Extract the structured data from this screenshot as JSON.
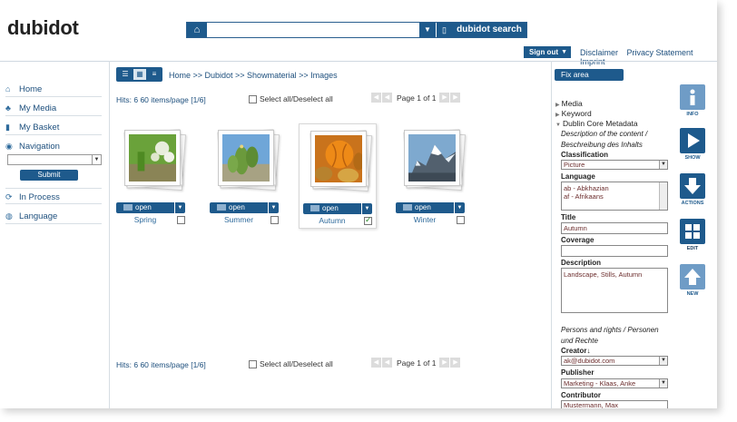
{
  "brand": {
    "logo": "dubidot"
  },
  "search": {
    "button_label": "dubidot search",
    "value": ""
  },
  "header": {
    "signout_label": "Sign out",
    "links": [
      "Disclaimer",
      "Privacy Statement",
      "Imprint"
    ]
  },
  "sidebar": {
    "items": [
      {
        "label": "Home",
        "icon": "home-icon"
      },
      {
        "label": "My Media",
        "icon": "media-icon"
      },
      {
        "label": "My Basket",
        "icon": "basket-icon"
      },
      {
        "label": "Navigation",
        "icon": "navigation-icon"
      }
    ],
    "nav_select_value": "",
    "submit_label": "Submit",
    "bottom_items": [
      {
        "label": "In Process",
        "icon": "refresh-icon"
      },
      {
        "label": "Language",
        "icon": "language-icon"
      }
    ]
  },
  "breadcrumb": "Home >> Dubidot >> Showmaterial >> Images",
  "results": {
    "hits_text": "Hits: 6  60 items/page [1/6]",
    "select_all_label": "Select all/Deselect all",
    "page_label": "Page 1 of 1"
  },
  "items": [
    {
      "caption": "Spring",
      "open_label": "open",
      "checked": false
    },
    {
      "caption": "Summer",
      "open_label": "open",
      "checked": false
    },
    {
      "caption": "Autumn",
      "open_label": "open",
      "checked": true
    },
    {
      "caption": "Winter",
      "open_label": "open",
      "checked": false
    }
  ],
  "panel": {
    "fix_area_label": "Fix area",
    "sections": [
      "Media",
      "Keyword",
      "Dublin Core Metadata"
    ],
    "content_heading_1": "Description of the content /",
    "content_heading_2": "Beschreibung des Inhalts",
    "classification_label": "Classification",
    "classification_value": "Picture",
    "language_label": "Language",
    "language_options": [
      "ab - Abkhazian",
      "af - Afrikaans"
    ],
    "title_label": "Title",
    "title_value": "Autumn",
    "coverage_label": "Coverage",
    "coverage_value": "",
    "description_label": "Description",
    "description_value": "Landscape, Stills, Autumn",
    "persons_heading_1": "Persons and rights / Personen",
    "persons_heading_2": "und Rechte",
    "creator_label": "Creator↓",
    "creator_value": "ak@dubidot.com",
    "publisher_label": "Publisher",
    "publisher_value": "Marketing - Klaas, Anke",
    "contributor_label": "Contributor",
    "contributor_value": "Mustermann, Max"
  },
  "actions": [
    {
      "label": "INFO",
      "icon": "info-icon"
    },
    {
      "label": "SHOW",
      "icon": "play-icon"
    },
    {
      "label": "ACTIONS",
      "icon": "download-arrow-icon"
    },
    {
      "label": "EDIT",
      "icon": "grid-icon"
    },
    {
      "label": "NEW",
      "icon": "upload-arrow-icon"
    }
  ],
  "colors": {
    "accent": "#1e5a8c",
    "link": "#1d4f7d",
    "field_text": "#6b2c2c"
  }
}
